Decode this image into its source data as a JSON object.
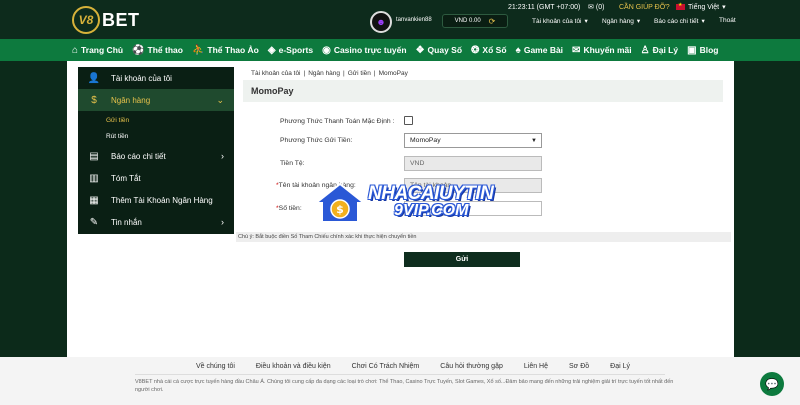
{
  "brand": {
    "logo_mark": "V8",
    "logo_text": "BET"
  },
  "topbar": {
    "clock": "21:23:11 (GMT +07:00)",
    "mail_count": "(0)",
    "help": "CẦN GIÚP ĐỠ?",
    "language": "Tiếng Việt",
    "username": "tanvankien88",
    "balance": "VND 0.00",
    "menus": [
      "Tài khoản của tôi",
      "Ngân hàng",
      "Báo cáo chi tiết"
    ],
    "logout": "Thoát"
  },
  "nav": {
    "items": [
      {
        "label": "Trang Chủ",
        "icon": "home-icon"
      },
      {
        "label": "Thể thao",
        "icon": "soccer-ball-icon"
      },
      {
        "label": "Thể Thao Ảo",
        "icon": "virtual-sport-icon"
      },
      {
        "label": "e-Sports",
        "icon": "gamepad-icon"
      },
      {
        "label": "Casino trực tuyến",
        "icon": "casino-chip-icon"
      },
      {
        "label": "Quay Số",
        "icon": "lottery-icon"
      },
      {
        "label": "Xổ Số",
        "icon": "lotto-ball-icon"
      },
      {
        "label": "Game Bài",
        "icon": "cards-icon"
      },
      {
        "label": "Khuyến mãi",
        "icon": "gift-icon"
      },
      {
        "label": "Đại Lý",
        "icon": "agent-icon"
      },
      {
        "label": "Blog",
        "icon": "blog-icon"
      }
    ]
  },
  "sidebar": {
    "items": [
      {
        "label": "Tài khoản của tôi",
        "icon": "user-icon"
      },
      {
        "label": "Ngân hàng",
        "icon": "dollar-circle-icon"
      },
      {
        "label": "Báo cáo chi tiết",
        "icon": "report-icon"
      },
      {
        "label": "Tóm Tắt",
        "icon": "summary-icon"
      },
      {
        "label": "Thêm Tài Khoản Ngân Hàng",
        "icon": "bank-icon"
      },
      {
        "label": "Tin nhắn",
        "icon": "message-icon"
      }
    ],
    "sub_items": [
      "Gửi tiền",
      "Rút tiền"
    ]
  },
  "breadcrumb": [
    "Tài khoản của tôi",
    "Ngân hàng",
    "Gửi tiền",
    "MomoPay"
  ],
  "page_title": "MomoPay",
  "form": {
    "default_method_label": "Phương Thức Thanh Toán Mặc Định :",
    "deposit_method_label": "Phương Thức Gửi Tiền:",
    "deposit_method_value": "MomoPay",
    "currency_label": "Tiền Tệ:",
    "currency_value": "VND",
    "account_name_label": "Tên tài khoản ngân hàng:",
    "account_name_placeholder": "Tên tài khoản",
    "amount_label": "Số tiền:",
    "amount_value": "",
    "note": "Chú ý: Bắt buộc điền Số Tham Chiếu chính xác khi thực hiện chuyển tiền",
    "submit": "Gửi"
  },
  "watermark": {
    "line1": "NHACAIUYTIN",
    "line2": "9VIP.COM"
  },
  "footer": {
    "links": [
      "Về chúng tôi",
      "Điều khoản và điều kiện",
      "Chơi Có Trách Nhiệm",
      "Câu hỏi thường gặp",
      "Liên Hệ",
      "Sơ Đồ",
      "Đại Lý"
    ],
    "text": "V8BET nhà cái cá cược trực tuyến hàng đầu Châu Á. Chúng tôi cung cấp đa dạng các loại trò chơi: Thể Thao, Casino Trực Tuyến, Slot Games, Xổ số...Đảm bảo mang đến những trải nghiệm giải trí trực tuyến tốt nhất đến người chơi."
  },
  "colors": {
    "header_bg": "#0d2b1c",
    "nav_bg": "#0d7a3e",
    "accent": "#e6c24b",
    "sidebar_bg": "#0a1f14"
  }
}
